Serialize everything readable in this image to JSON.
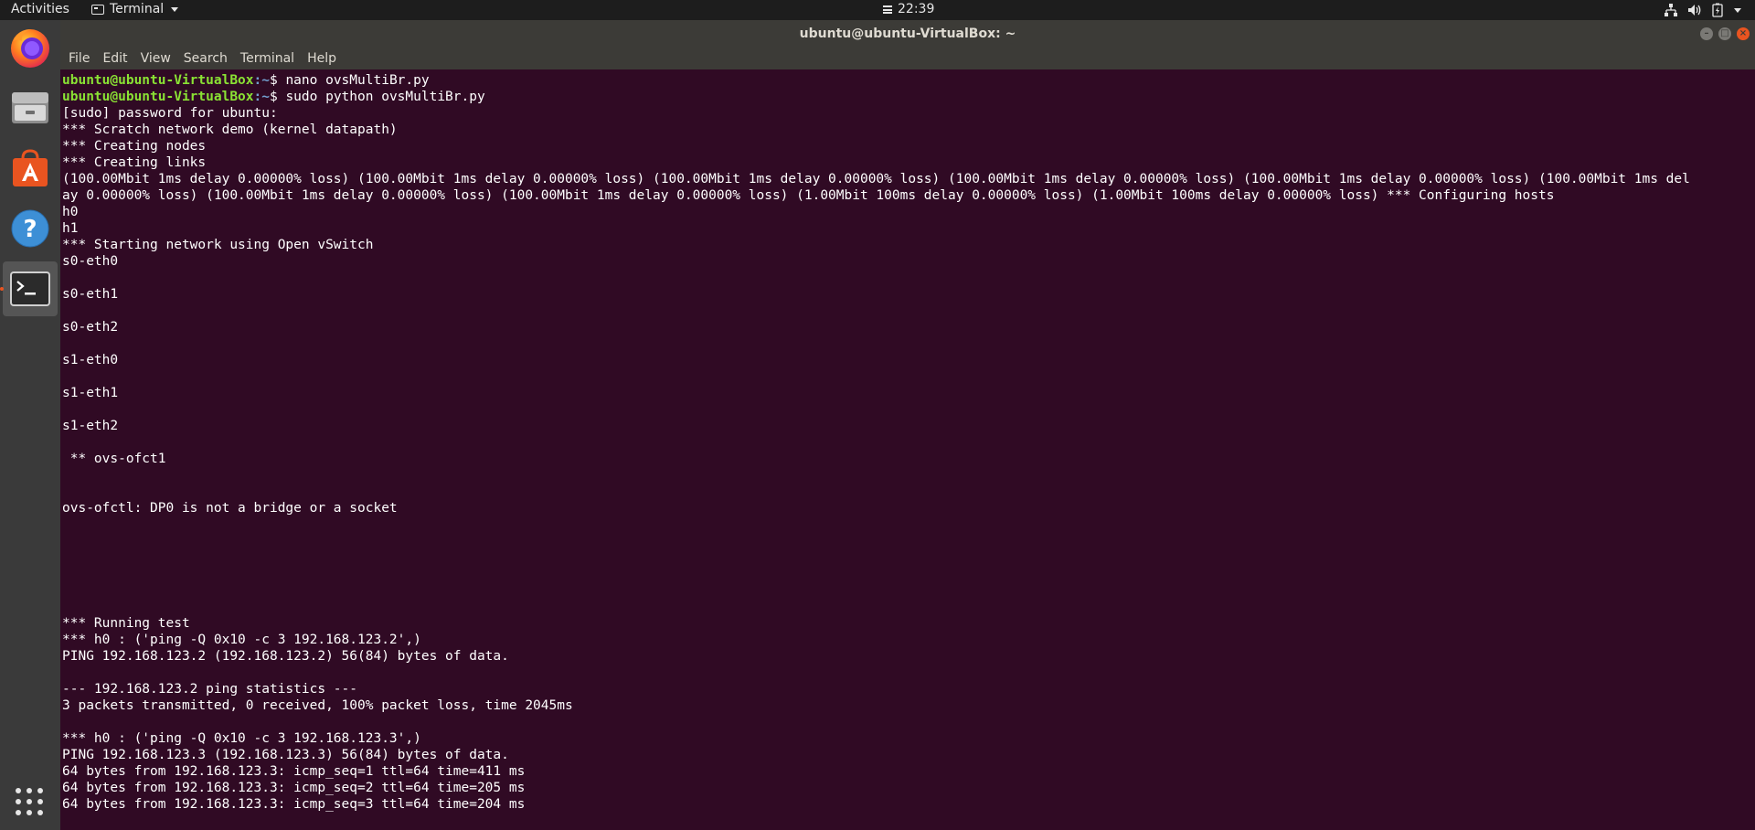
{
  "topbar": {
    "activities": "Activities",
    "app_name": "Terminal",
    "clock": "22:39",
    "tray_icons": [
      "network-icon",
      "volume-icon",
      "battery-icon",
      "system-menu-caret-icon"
    ]
  },
  "dock": {
    "items": [
      {
        "name": "firefox",
        "icon": "firefox-icon"
      },
      {
        "name": "files",
        "icon": "files-icon"
      },
      {
        "name": "software",
        "icon": "software-center-icon"
      },
      {
        "name": "help",
        "icon": "help-icon"
      },
      {
        "name": "terminal",
        "icon": "terminal-icon",
        "active": true
      }
    ],
    "show_apps": "apps-grid-icon"
  },
  "window": {
    "title": "ubuntu@ubuntu-VirtualBox: ~",
    "menu": [
      "File",
      "Edit",
      "View",
      "Search",
      "Terminal",
      "Help"
    ]
  },
  "terminal": {
    "prompt_user": "ubuntu@ubuntu-VirtualBox",
    "prompt_path": ":~",
    "prompt_symbol": "$ ",
    "commands": [
      "nano ovsMultiBr.py",
      "sudo python ovsMultiBr.py"
    ],
    "output": "[sudo] password for ubuntu:\n*** Scratch network demo (kernel datapath)\n*** Creating nodes\n*** Creating links\n(100.00Mbit 1ms delay 0.00000% loss) (100.00Mbit 1ms delay 0.00000% loss) (100.00Mbit 1ms delay 0.00000% loss) (100.00Mbit 1ms delay 0.00000% loss) (100.00Mbit 1ms delay 0.00000% loss) (100.00Mbit 1ms del\nay 0.00000% loss) (100.00Mbit 1ms delay 0.00000% loss) (100.00Mbit 1ms delay 0.00000% loss) (1.00Mbit 100ms delay 0.00000% loss) (1.00Mbit 100ms delay 0.00000% loss) *** Configuring hosts\nh0\nh1\n*** Starting network using Open vSwitch\ns0-eth0\n\ns0-eth1\n\ns0-eth2\n\ns1-eth0\n\ns1-eth1\n\ns1-eth2\n\n ** ovs-ofct1\n\n\novs-ofctl: DP0 is not a bridge or a socket\n\n\n\n\n\n\n*** Running test\n*** h0 : ('ping -Q 0x10 -c 3 192.168.123.2',)\nPING 192.168.123.2 (192.168.123.2) 56(84) bytes of data.\n\n--- 192.168.123.2 ping statistics ---\n3 packets transmitted, 0 received, 100% packet loss, time 2045ms\n\n*** h0 : ('ping -Q 0x10 -c 3 192.168.123.3',)\nPING 192.168.123.3 (192.168.123.3) 56(84) bytes of data.\n64 bytes from 192.168.123.3: icmp_seq=1 ttl=64 time=411 ms\n64 bytes from 192.168.123.3: icmp_seq=2 ttl=64 time=205 ms\n64 bytes from 192.168.123.3: icmp_seq=3 ttl=64 time=204 ms"
  },
  "colors": {
    "terminal_bg": "#300a24",
    "prompt_user": "#8ae234",
    "prompt_path": "#729fcf",
    "accent": "#e95420"
  }
}
